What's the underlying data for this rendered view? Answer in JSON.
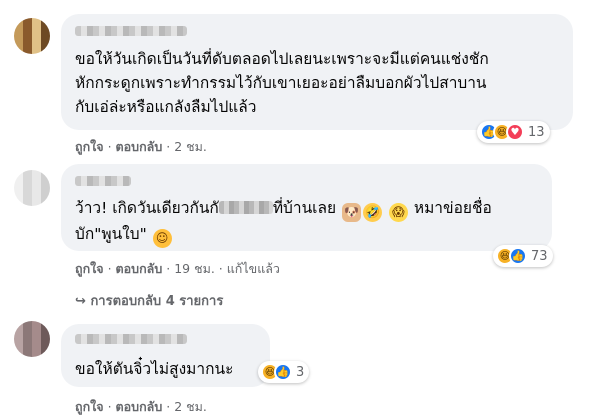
{
  "comments": [
    {
      "text_lines": [
        "ขอให้วันเกิดเป็นวันที่ดับตลอดไปเลยนะเพราะจะมีแต่คนแช่งชัก",
        "หักกระดูกเพราะทำกรรมไว้กับเขาเยอะอย่าลืมบอกผัวไปสาบาน",
        "กับเอ่ล่ะหรือแกลังลืมไปแล้ว"
      ],
      "like": "ถูกใจ",
      "reply": "ตอบกลับ",
      "time": "2 ชม.",
      "reaction_count": "13",
      "reaction_icons": [
        "like-icon",
        "haha-icon",
        "love-icon"
      ]
    },
    {
      "line1_a": "ว้าว! เกิดวันเดียวกันกั",
      "line1_b": "ที่บ้านเลย",
      "line1_c": "หมาข่อยชื่อ",
      "line2": "บัก\"พูนใบ\"",
      "like": "ถูกใจ",
      "reply": "ตอบกลับ",
      "time": "19 ชม.",
      "edited": "แก้ไขแล้ว",
      "reaction_count": "73",
      "reaction_icons": [
        "haha-icon",
        "like-icon"
      ]
    },
    {
      "text": "ขอให้ตันจิ๋วไม่สูงมากนะ",
      "like": "ถูกใจ",
      "reply": "ตอบกลับ",
      "time": "2 ชม.",
      "reaction_count": "3",
      "reaction_icons": [
        "haha-icon",
        "like-icon"
      ]
    }
  ],
  "replies_link": "การตอบกลับ 4 รายการ",
  "separator": "·",
  "arrow": "↪",
  "colors": {
    "bubble": "#f0f2f5",
    "meta": "#65676b",
    "like_blue": "#1877f2",
    "love_red": "#f33e58",
    "haha_yellow": "#f7b125"
  }
}
